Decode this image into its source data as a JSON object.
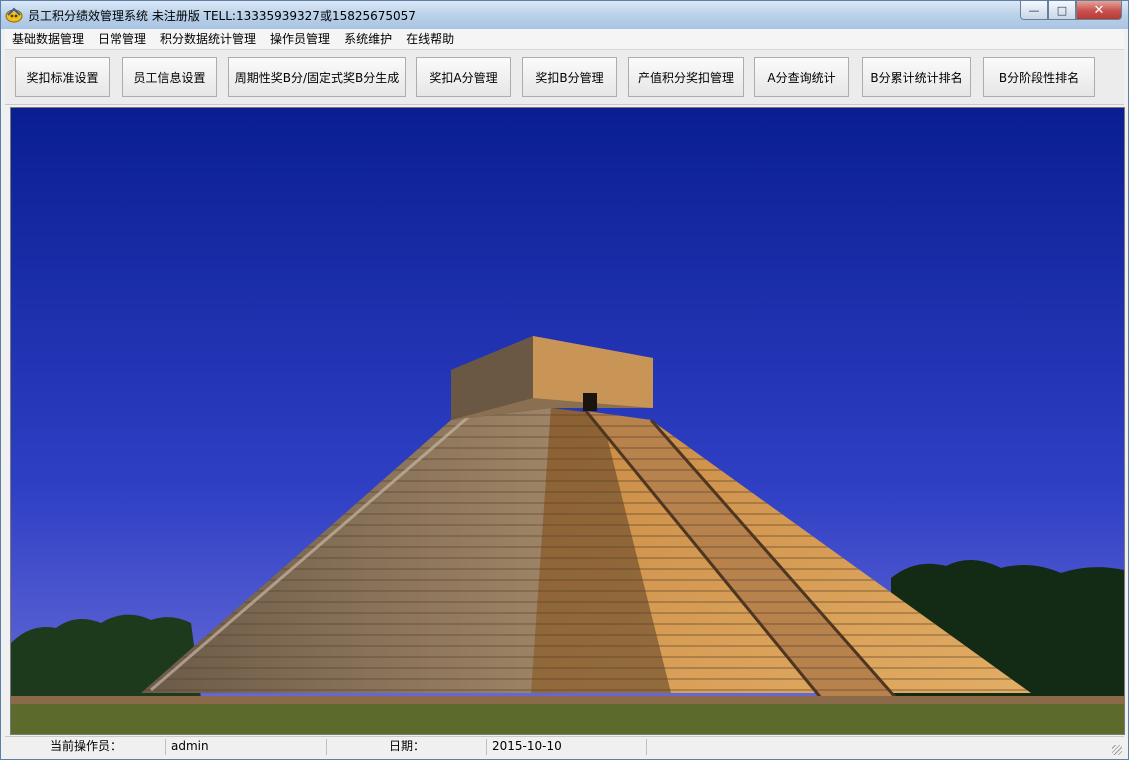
{
  "window": {
    "title": "员工积分绩效管理系统 未注册版 TELL:13335939327或15825675057",
    "minimize_label": "—",
    "maximize_label": "□",
    "close_label": "✕"
  },
  "menu": [
    "基础数据管理",
    "日常管理",
    "积分数据统计管理",
    "操作员管理",
    "系统维护",
    "在线帮助"
  ],
  "toolbar": [
    "奖扣标准设置",
    "员工信息设置",
    "周期性奖B分/固定式奖B分生成",
    "奖扣A分管理",
    "奖扣B分管理",
    "产值积分奖扣管理",
    "A分查询统计",
    "B分累计统计排名",
    "B分阶段性排名"
  ],
  "status": {
    "operator_label": "当前操作员：",
    "operator_value": "admin",
    "date_label": "日期：",
    "date_value": "2015-10-10"
  },
  "colors": {
    "sky_top": "#0b1f94",
    "sky_bottom": "#5b63d6",
    "stone_light": "#d9a05a",
    "stone_shadow": "#4a3a2e",
    "grass": "#4c6a2a"
  },
  "icons": {
    "app": "app-logo-icon"
  }
}
